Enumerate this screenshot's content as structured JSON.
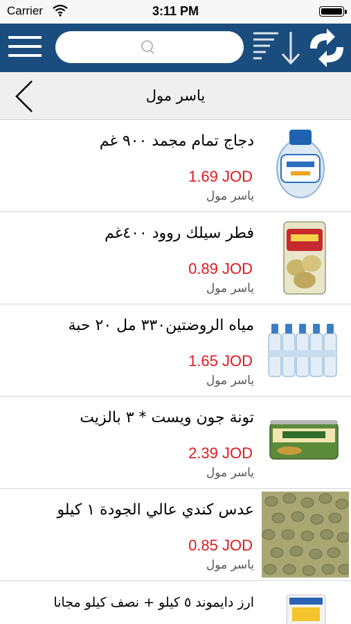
{
  "status": {
    "carrier": "Carrier",
    "time": "3:11 PM"
  },
  "navbar": {
    "menu_icon": "hamburger-menu-icon",
    "search_placeholder": "",
    "sort_icon": "sort-descending-icon",
    "refresh_icon": "refresh-arrows-icon",
    "color": "#1a4d7e"
  },
  "subbar": {
    "title": "ياسر مول",
    "back_icon": "chevron-left-icon"
  },
  "products": [
    {
      "name": "دجاج تمام مجمد ٩٠٠ غم",
      "price": "1.69 JOD",
      "store": "ياسر مول",
      "image": "frozen-chicken"
    },
    {
      "name": "فطر سيلك روود ٤٠٠غم",
      "price": "0.89 JOD",
      "store": "ياسر مول",
      "image": "mushroom-can"
    },
    {
      "name": "مياه الروضتين٣٣٠ مل ٢٠ حبة",
      "price": "1.65 JOD",
      "store": "ياسر مول",
      "image": "water-bottles-pack"
    },
    {
      "name": "تونة جون ويست * ٣ بالزيت",
      "price": "2.39 JOD",
      "store": "ياسر مول",
      "image": "tuna-can"
    },
    {
      "name": "عدس كندي عالي الجودة ١ كيلو",
      "price": "0.85 JOD",
      "store": "ياسر مول",
      "image": "lentils"
    },
    {
      "name": "ارز دايموند ٥ كيلو + نصف كيلو مجانا",
      "price": "",
      "store": "",
      "image": "rice-bag"
    }
  ],
  "colors": {
    "price": "#e1191d",
    "navbar": "#1a4d7e"
  }
}
